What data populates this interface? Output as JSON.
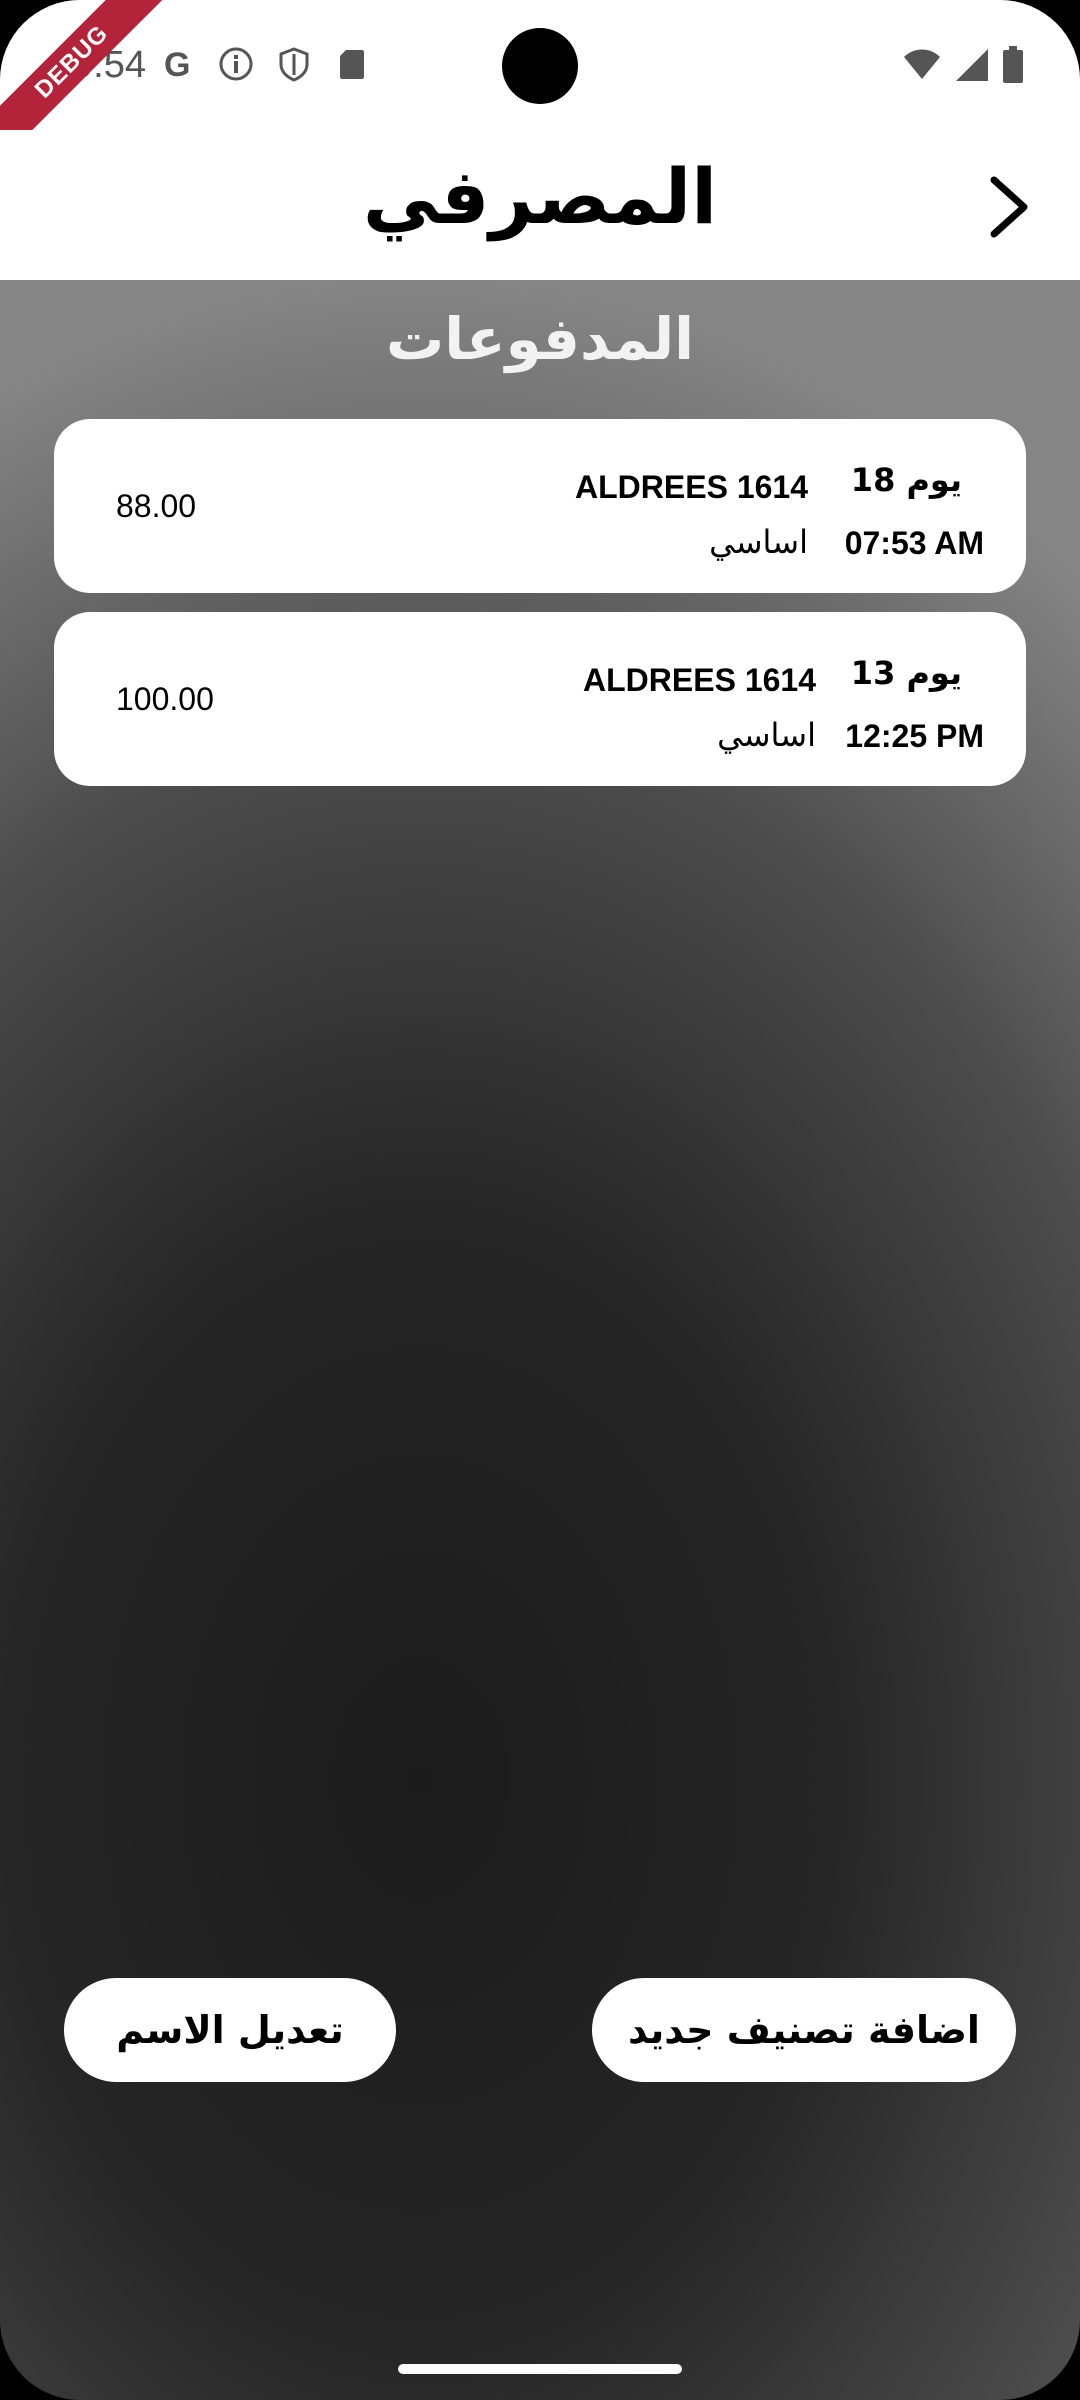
{
  "status_bar": {
    "time": "9:54",
    "left_icons": [
      "google-icon",
      "info-icon",
      "shield-icon",
      "sd-card-icon"
    ],
    "right_icons": [
      "wifi-icon",
      "signal-icon",
      "battery-icon"
    ],
    "debug_label": "DEBUG"
  },
  "appbar": {
    "title": "المصرفي",
    "back_icon": "chevron-right-icon"
  },
  "section_title": "المدفوعات",
  "payments": [
    {
      "day": "يوم 18",
      "time": "07:53 AM",
      "merchant": "ALDREES 1614",
      "category": "اساسي",
      "amount": "88.00"
    },
    {
      "day": "يوم 13",
      "time": "12:25 PM",
      "merchant": "ALDREES 1614",
      "category": "اساسي",
      "amount": "100.00"
    }
  ],
  "buttons": {
    "rename": "تعديل الاسم",
    "add_category": "اضافة تصنيف جديد"
  },
  "colors": {
    "card_bg": "#ffffff",
    "debug_banner": "#b3243b"
  }
}
